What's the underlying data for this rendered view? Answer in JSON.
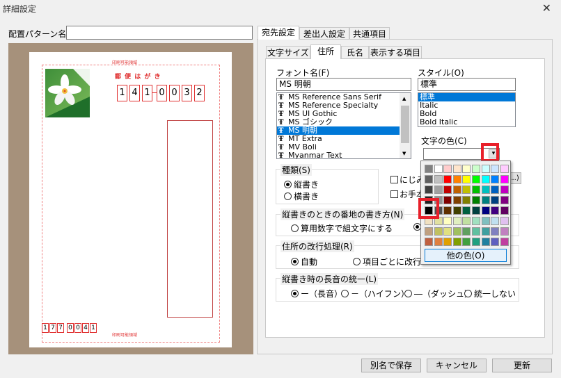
{
  "window": {
    "title": "詳細設定",
    "close_glyph": "✕"
  },
  "layout_pattern": {
    "label": "配置パターン名",
    "value": ""
  },
  "postcard": {
    "print_area_top": "印刷可能領域",
    "print_area_bottom": "印刷可能領域",
    "heading": "郵 便 は が き",
    "recipient_zip": [
      "1",
      "4",
      "1",
      "0",
      "0",
      "3",
      "2"
    ],
    "sender_zip": [
      "1",
      "7",
      "7",
      "0",
      "0",
      "4",
      "1"
    ]
  },
  "outer_tabs": [
    "宛先設定",
    "差出人設定",
    "共通項目"
  ],
  "inner_tabs": [
    "文字サイズ",
    "住所",
    "氏名",
    "表示する項目"
  ],
  "font": {
    "label": "フォント名(F)",
    "value": "MS 明朝",
    "items": [
      "MS Reference Sans Serif",
      "MS Reference Specialty",
      "MS UI Gothic",
      "MS ゴシック",
      "MS 明朝",
      "MT Extra",
      "MV Boli",
      "Myanmar Text"
    ],
    "icon_glyph": "Ŧ",
    "selected_index": 4
  },
  "style": {
    "label": "スタイル(O)",
    "value": "標準",
    "items": [
      "標準",
      "Italic",
      "Bold",
      "Bold Italic"
    ],
    "selected_index": 0
  },
  "text_color": {
    "label": "文字の色(C)",
    "dropdown_glyph": "▾",
    "other_colors_label": "他の色(O)",
    "ellipsis_label": "...)"
  },
  "kind": {
    "label": "種類(S)",
    "options": [
      "縦書き",
      "横書き"
    ],
    "selected_index": 0
  },
  "checkboxes": {
    "blur": "にじみ",
    "handwriting": "お手本"
  },
  "number_style": {
    "label": "縦書きのときの番地の書き方(N)",
    "options": [
      "算用数字で組文字にする"
    ]
  },
  "line_break": {
    "label": "住所の改行処理(R)",
    "options": [
      "自動",
      "項目ごとに改行"
    ],
    "selected_index": 0
  },
  "long_vowel": {
    "label": "縦書き時の長音の統一(L)",
    "options": [
      "ー（長音）",
      "－（ハイフン）",
      "―（ダッシュ）",
      "統一しない"
    ],
    "selected_index": 0
  },
  "buttons": {
    "save_as": "別名で保存",
    "cancel": "キャンセル",
    "update": "更新"
  },
  "palette": [
    [
      "#808080",
      "#ffffff",
      "#ffcccc",
      "#ffe5cc",
      "#ffffcc",
      "#ccffcc",
      "#ccffff",
      "#cce5ff",
      "#ffccff"
    ],
    [
      "#606060",
      "#c0c0c0",
      "#ff0000",
      "#ff8000",
      "#ffff00",
      "#00ff00",
      "#00ffff",
      "#0080ff",
      "#ff00ff"
    ],
    [
      "#404040",
      "#a0a0a0",
      "#c00000",
      "#c06000",
      "#c0c000",
      "#00c000",
      "#00c0c0",
      "#0060c0",
      "#c000c0"
    ],
    [
      "#202020",
      "#909090",
      "#800000",
      "#804000",
      "#808000",
      "#008000",
      "#008080",
      "#004080",
      "#800080"
    ],
    [
      "#000000",
      "#505050",
      "#603000",
      "#404000",
      "#006040",
      "#004040",
      "#000080",
      "#400080",
      "#600060"
    ],
    [
      "#f0e0c0",
      "#e0e0a0",
      "#ffffc0",
      "#e0f0c0",
      "#c0e0a0",
      "#a0e0c0",
      "#80c0c0",
      "#c0e0f0",
      "#e0c0f0"
    ],
    [
      "#c0a080",
      "#c0c060",
      "#e0e080",
      "#a0c060",
      "#60a060",
      "#60c0a0",
      "#40a0a0",
      "#8080c0",
      "#c080c0"
    ],
    [
      "#c06040",
      "#e08040",
      "#e0a000",
      "#80a000",
      "#40a040",
      "#20a080",
      "#2080a0",
      "#6060c0",
      "#c040a0"
    ]
  ]
}
